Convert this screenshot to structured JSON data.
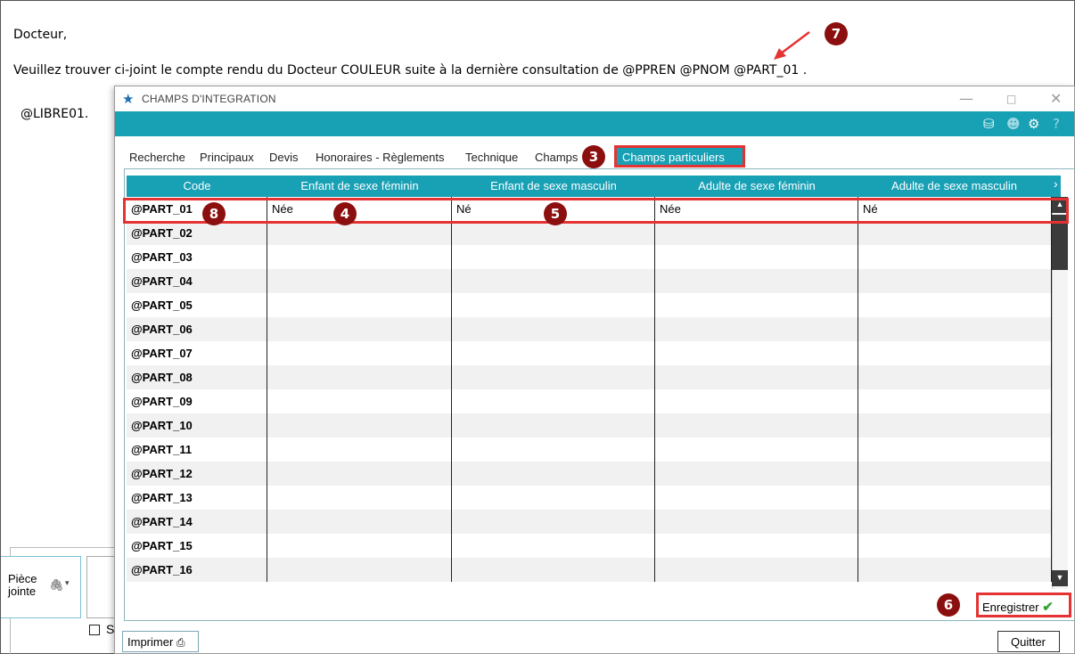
{
  "document": {
    "greeting": "Docteur,",
    "body_line": "Veuillez trouver ci-joint le compte rendu du Docteur COULEUR suite à la dernière consultation de @PPREN @PNOM @PART_01 .",
    "libre_line": "@LIBRE01.",
    "attachment_label_1": "Pièce",
    "attachment_label_2": "jointe",
    "checkbox_label": "S"
  },
  "dialog": {
    "title": "CHAMPS D'INTEGRATION",
    "tabs": [
      "Recherche",
      "Principaux",
      "Devis",
      "Honoraires - Règlements",
      "Technique",
      "Champs"
    ],
    "active_tab": "Champs particuliers",
    "columns": [
      "Code",
      "Enfant de sexe féminin",
      "Enfant de sexe masculin",
      "Adulte de sexe féminin",
      "Adulte de sexe masculin"
    ],
    "rows": [
      [
        "@PART_01",
        "Née",
        "Né",
        "Née",
        "Né"
      ],
      [
        "@PART_02",
        "",
        "",
        "",
        ""
      ],
      [
        "@PART_03",
        "",
        "",
        "",
        ""
      ],
      [
        "@PART_04",
        "",
        "",
        "",
        ""
      ],
      [
        "@PART_05",
        "",
        "",
        "",
        ""
      ],
      [
        "@PART_06",
        "",
        "",
        "",
        ""
      ],
      [
        "@PART_07",
        "",
        "",
        "",
        ""
      ],
      [
        "@PART_08",
        "",
        "",
        "",
        ""
      ],
      [
        "@PART_09",
        "",
        "",
        "",
        ""
      ],
      [
        "@PART_10",
        "",
        "",
        "",
        ""
      ],
      [
        "@PART_11",
        "",
        "",
        "",
        ""
      ],
      [
        "@PART_12",
        "",
        "",
        "",
        ""
      ],
      [
        "@PART_13",
        "",
        "",
        "",
        ""
      ],
      [
        "@PART_14",
        "",
        "",
        "",
        ""
      ],
      [
        "@PART_15",
        "",
        "",
        "",
        ""
      ],
      [
        "@PART_16",
        "",
        "",
        "",
        ""
      ]
    ],
    "save_label": "Enregistrer",
    "print_label": "Imprimer",
    "quit_label": "Quitter"
  },
  "badges": {
    "tab": "3",
    "col_girl": "4",
    "col_boy": "5",
    "save": "6",
    "field": "7",
    "code": "8"
  },
  "colors": {
    "accent": "#18a0b5",
    "highlight": "#e53333",
    "badge": "#8c0f0f"
  },
  "icons": [
    "star-icon",
    "minimize-icon",
    "maximize-icon",
    "close-icon",
    "settings-icon",
    "help-icon",
    "printer-icon",
    "check-icon",
    "paperclip-icon"
  ]
}
